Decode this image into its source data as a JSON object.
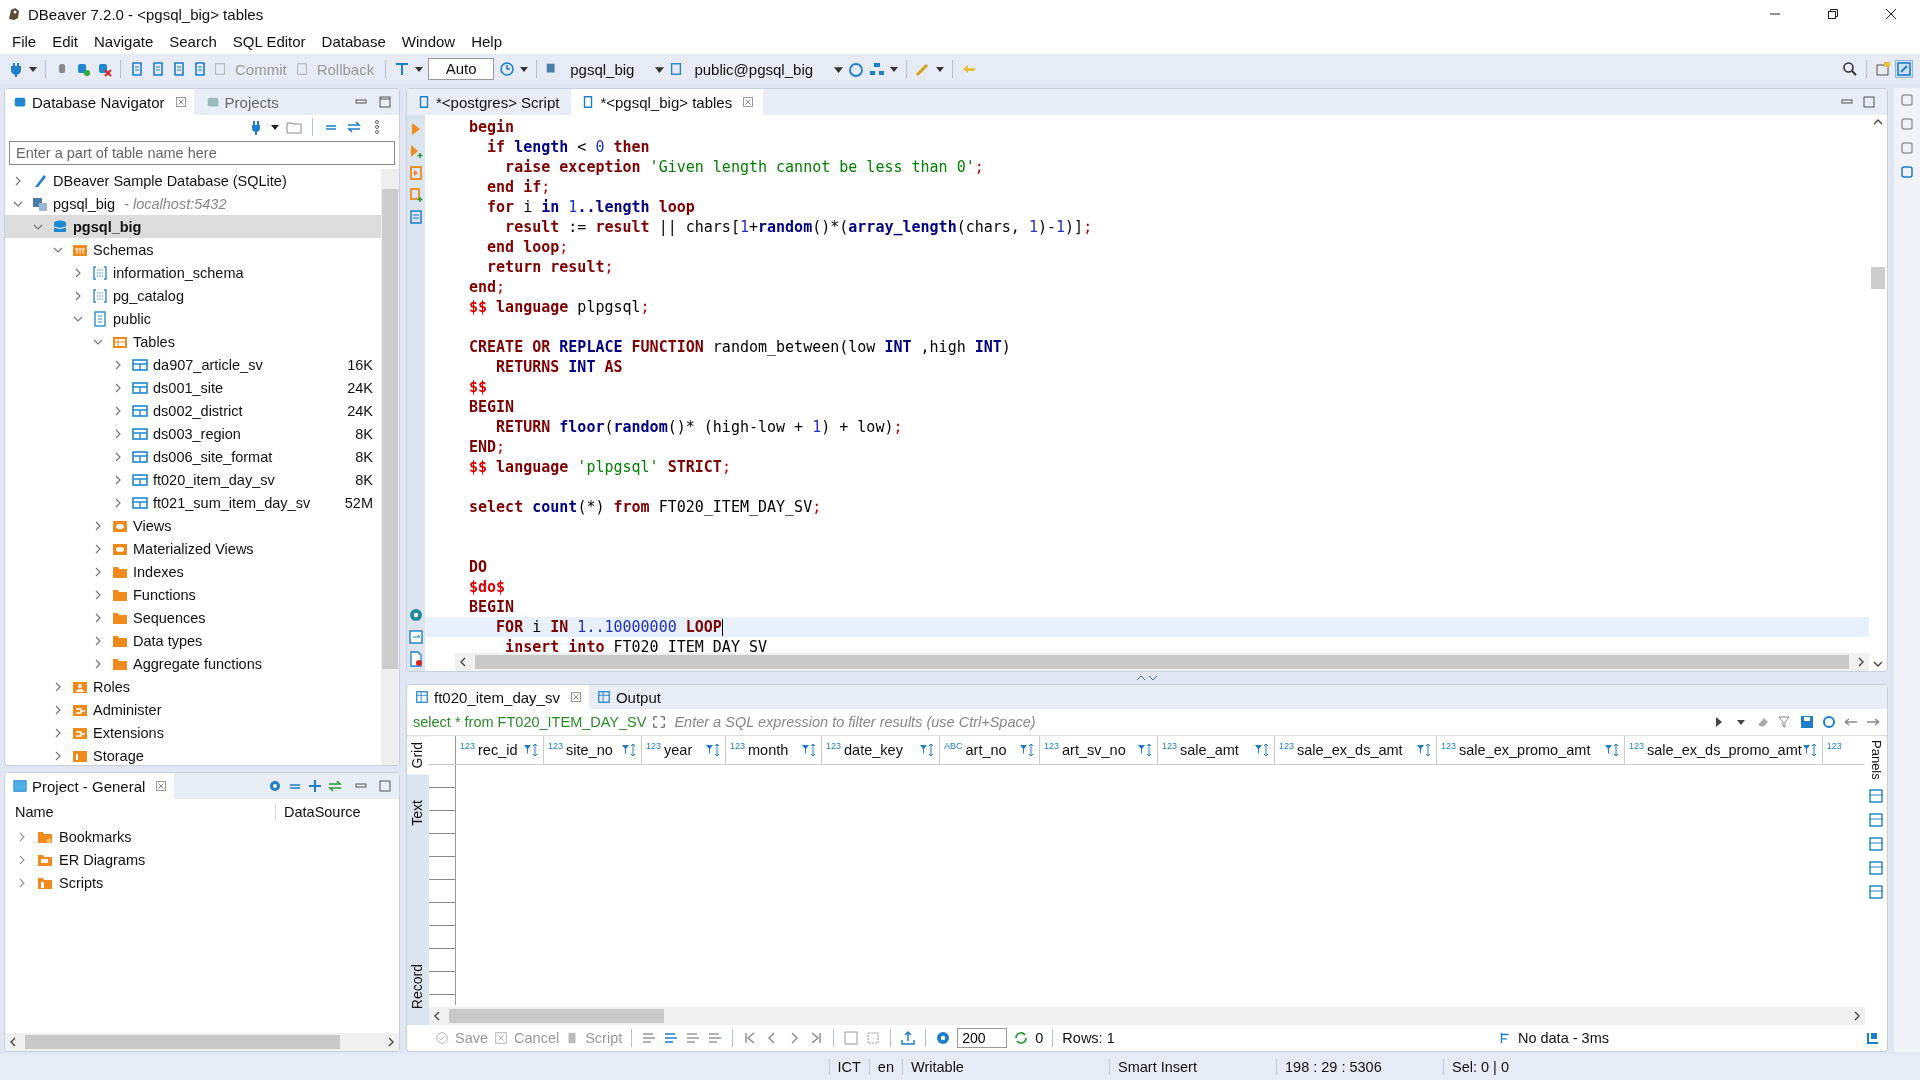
{
  "window": {
    "title": "DBeaver 7.2.0 - <pgsql_big> tables"
  },
  "menu": [
    "File",
    "Edit",
    "Navigate",
    "Search",
    "SQL Editor",
    "Database",
    "Window",
    "Help"
  ],
  "toolbar": {
    "commit": "Commit",
    "rollback": "Rollback",
    "mode": "Auto",
    "datasource": "pgsql_big",
    "schema": "public@pgsql_big"
  },
  "navigator": {
    "tabs": [
      {
        "label": "Database Navigator",
        "selected": true
      },
      {
        "label": "Projects",
        "selected": false
      }
    ],
    "filter_placeholder": "Enter a part of table name here",
    "tree": [
      {
        "label": "DBeaver Sample Database (SQLite)",
        "kind": "sqlite",
        "expanded": false,
        "selected": false
      },
      {
        "label": "pgsql_big",
        "detail": "- localhost:5432",
        "kind": "connection",
        "expanded": true,
        "selected": false,
        "children": [
          {
            "label": "pgsql_big",
            "kind": "database",
            "expanded": true,
            "selected": true,
            "children": [
              {
                "label": "Schemas",
                "kind": "schemas",
                "expanded": true,
                "selected": false,
                "children": [
                  {
                    "label": "information_schema",
                    "kind": "schema",
                    "expanded": false,
                    "selected": false
                  },
                  {
                    "label": "pg_catalog",
                    "kind": "schema",
                    "expanded": false,
                    "selected": false
                  },
                  {
                    "label": "public",
                    "kind": "public",
                    "expanded": true,
                    "selected": false,
                    "children": [
                      {
                        "label": "Tables",
                        "kind": "tables",
                        "expanded": true,
                        "selected": false,
                        "children": [
                          {
                            "label": "da907_article_sv",
                            "size": "16K",
                            "kind": "table",
                            "expanded": false,
                            "selected": false
                          },
                          {
                            "label": "ds001_site",
                            "size": "24K",
                            "kind": "table",
                            "expanded": false,
                            "selected": false
                          },
                          {
                            "label": "ds002_district",
                            "size": "24K",
                            "kind": "table",
                            "expanded": false,
                            "selected": false
                          },
                          {
                            "label": "ds003_region",
                            "size": "8K",
                            "kind": "table",
                            "expanded": false,
                            "selected": false
                          },
                          {
                            "label": "ds006_site_format",
                            "size": "8K",
                            "kind": "table",
                            "expanded": false,
                            "selected": false
                          },
                          {
                            "label": "ft020_item_day_sv",
                            "size": "8K",
                            "kind": "table",
                            "expanded": false,
                            "selected": false
                          },
                          {
                            "label": "ft021_sum_item_day_sv",
                            "size": "52M",
                            "kind": "table",
                            "expanded": false,
                            "selected": false
                          }
                        ]
                      },
                      {
                        "label": "Views",
                        "kind": "view",
                        "expanded": false,
                        "selected": false
                      },
                      {
                        "label": "Materialized Views",
                        "kind": "view",
                        "expanded": false,
                        "selected": false
                      },
                      {
                        "label": "Indexes",
                        "kind": "folder",
                        "expanded": false,
                        "selected": false
                      },
                      {
                        "label": "Functions",
                        "kind": "folder",
                        "expanded": false,
                        "selected": false
                      },
                      {
                        "label": "Sequences",
                        "kind": "folder",
                        "expanded": false,
                        "selected": false
                      },
                      {
                        "label": "Data types",
                        "kind": "folder",
                        "expanded": false,
                        "selected": false
                      },
                      {
                        "label": "Aggregate functions",
                        "kind": "folder",
                        "expanded": false,
                        "selected": false
                      }
                    ]
                  }
                ]
              },
              {
                "label": "Roles",
                "kind": "roles",
                "expanded": false,
                "selected": false
              },
              {
                "label": "Administer",
                "kind": "admin",
                "expanded": false,
                "selected": false
              },
              {
                "label": "Extensions",
                "kind": "admin",
                "expanded": false,
                "selected": false
              },
              {
                "label": "Storage",
                "kind": "storage",
                "expanded": false,
                "selected": false
              }
            ]
          }
        ]
      }
    ]
  },
  "project": {
    "title": "Project - General",
    "columns": [
      "Name",
      "DataSource"
    ],
    "items": [
      {
        "label": "Bookmarks",
        "kind": "bookmarks"
      },
      {
        "label": "ER Diagrams",
        "kind": "diagrams"
      },
      {
        "label": "Scripts",
        "kind": "scripts"
      }
    ]
  },
  "editor": {
    "tabs": [
      {
        "label": "*<postgres> Script",
        "selected": false
      },
      {
        "label": "*<pgsql_big> tables",
        "selected": true
      }
    ],
    "lines": [
      {
        "current": false,
        "tokens": [
          {
            "kind": "kw",
            "text": "begin"
          }
        ]
      },
      {
        "current": false,
        "tokens": [
          {
            "kind": "kw",
            "text": "  if"
          },
          {
            "kind": "name",
            "text": " length"
          },
          {
            "kind": "plain",
            "text": " < "
          },
          {
            "kind": "num",
            "text": "0"
          },
          {
            "kind": "kw",
            "text": " then"
          }
        ]
      },
      {
        "current": false,
        "tokens": [
          {
            "kind": "kw",
            "text": "    raise exception"
          },
          {
            "kind": "str",
            "text": " 'Given length cannot be less than 0'"
          },
          {
            "kind": "punct",
            "text": ";"
          }
        ]
      },
      {
        "current": false,
        "tokens": [
          {
            "kind": "kw",
            "text": "  end if"
          },
          {
            "kind": "punct",
            "text": ";"
          }
        ]
      },
      {
        "current": false,
        "tokens": [
          {
            "kind": "kw",
            "text": "  for"
          },
          {
            "kind": "plain",
            "text": " i "
          },
          {
            "kind": "name",
            "text": "in"
          },
          {
            "kind": "num",
            "text": " 1"
          },
          {
            "kind": "name",
            "text": "..length"
          },
          {
            "kind": "kw",
            "text": " loop"
          }
        ]
      },
      {
        "current": false,
        "tokens": [
          {
            "kind": "kw",
            "text": "    result"
          },
          {
            "kind": "plain",
            "text": " := "
          },
          {
            "kind": "kw",
            "text": "result"
          },
          {
            "kind": "plain",
            "text": " || chars["
          },
          {
            "kind": "num",
            "text": "1"
          },
          {
            "kind": "plain",
            "text": "+"
          },
          {
            "kind": "name",
            "text": "random"
          },
          {
            "kind": "plain",
            "text": "()*("
          },
          {
            "kind": "name",
            "text": "array_length"
          },
          {
            "kind": "plain",
            "text": "(chars, "
          },
          {
            "kind": "num",
            "text": "1"
          },
          {
            "kind": "plain",
            "text": ")-"
          },
          {
            "kind": "num",
            "text": "1"
          },
          {
            "kind": "plain",
            "text": ")]"
          },
          {
            "kind": "punct",
            "text": ";"
          }
        ]
      },
      {
        "current": false,
        "tokens": [
          {
            "kind": "kw",
            "text": "  end loop"
          },
          {
            "kind": "punct",
            "text": ";"
          }
        ]
      },
      {
        "current": false,
        "tokens": [
          {
            "kind": "kw",
            "text": "  return result"
          },
          {
            "kind": "punct",
            "text": ";"
          }
        ]
      },
      {
        "current": false,
        "tokens": [
          {
            "kind": "kw",
            "text": "end"
          },
          {
            "kind": "punct",
            "text": ";"
          }
        ]
      },
      {
        "current": false,
        "tokens": [
          {
            "kind": "var",
            "text": "$$"
          },
          {
            "kind": "kw",
            "text": " language"
          },
          {
            "kind": "plain",
            "text": " plpgsql"
          },
          {
            "kind": "punct",
            "text": ";"
          }
        ]
      },
      {
        "current": false
      },
      {
        "current": false,
        "tokens": [
          {
            "kind": "kw",
            "text": "CREATE OR"
          },
          {
            "kind": "name",
            "text": " REPLACE"
          },
          {
            "kind": "kw",
            "text": " FUNCTION"
          },
          {
            "kind": "plain",
            "text": " random_between(low "
          },
          {
            "kind": "name",
            "text": "INT"
          },
          {
            "kind": "plain",
            "text": " ,high "
          },
          {
            "kind": "name",
            "text": "INT"
          },
          {
            "kind": "plain",
            "text": ")"
          }
        ]
      },
      {
        "current": false,
        "tokens": [
          {
            "kind": "kw",
            "text": "   RETURNS"
          },
          {
            "kind": "name",
            "text": " INT"
          },
          {
            "kind": "kw",
            "text": " AS"
          }
        ]
      },
      {
        "current": false,
        "tokens": [
          {
            "kind": "var",
            "text": "$$"
          }
        ]
      },
      {
        "current": false,
        "tokens": [
          {
            "kind": "kw",
            "text": "BEGIN"
          }
        ]
      },
      {
        "current": false,
        "tokens": [
          {
            "kind": "kw",
            "text": "   RETURN"
          },
          {
            "kind": "name",
            "text": " floor"
          },
          {
            "kind": "plain",
            "text": "("
          },
          {
            "kind": "name",
            "text": "random"
          },
          {
            "kind": "plain",
            "text": "()* (high-low + "
          },
          {
            "kind": "num",
            "text": "1"
          },
          {
            "kind": "plain",
            "text": ") + low)"
          },
          {
            "kind": "punct",
            "text": ";"
          }
        ]
      },
      {
        "current": false,
        "tokens": [
          {
            "kind": "kw",
            "text": "END"
          },
          {
            "kind": "punct",
            "text": ";"
          }
        ]
      },
      {
        "current": false,
        "tokens": [
          {
            "kind": "var",
            "text": "$$"
          },
          {
            "kind": "kw",
            "text": " language"
          },
          {
            "kind": "str",
            "text": " 'plpgsql'"
          },
          {
            "kind": "kw",
            "text": " STRICT"
          },
          {
            "kind": "punct",
            "text": ";"
          }
        ]
      },
      {
        "current": false
      },
      {
        "current": false,
        "tokens": [
          {
            "kind": "kw",
            "text": "select"
          },
          {
            "kind": "name",
            "text": " count"
          },
          {
            "kind": "plain",
            "text": "(*) "
          },
          {
            "kind": "kw",
            "text": "from"
          },
          {
            "kind": "plain",
            "text": " FT020_ITEM_DAY_SV"
          },
          {
            "kind": "punct",
            "text": ";"
          }
        ]
      },
      {
        "current": false
      },
      {
        "current": false
      },
      {
        "current": false,
        "tokens": [
          {
            "kind": "kw",
            "text": "DO"
          }
        ]
      },
      {
        "current": false,
        "tokens": [
          {
            "kind": "var",
            "text": "$do$"
          }
        ]
      },
      {
        "current": false,
        "tokens": [
          {
            "kind": "kw",
            "text": "BEGIN"
          }
        ]
      },
      {
        "current": true,
        "tokens": [
          {
            "kind": "kw",
            "text": "   FOR"
          },
          {
            "kind": "plain",
            "text": " i "
          },
          {
            "kind": "kw",
            "text": "IN"
          },
          {
            "kind": "num",
            "text": " 1..10000000"
          },
          {
            "kind": "kw",
            "text": " LOOP"
          }
        ]
      },
      {
        "current": false,
        "tokens": [
          {
            "kind": "kw",
            "text": "    insert into"
          },
          {
            "kind": "plain",
            "text": " FT020 ITEM DAY SV"
          }
        ]
      }
    ]
  },
  "results": {
    "tabs": [
      {
        "label": "ft020_item_day_sv",
        "selected": true
      },
      {
        "label": "Output",
        "selected": false
      }
    ],
    "query": "select * from FT020_ITEM_DAY_SV",
    "filter_placeholder": "Enter a SQL expression to filter results (use Ctrl+Space)",
    "side_tabs": [
      {
        "label": "Grid",
        "selected": true
      },
      {
        "label": "Text",
        "selected": false
      },
      {
        "label": "Record",
        "selected": false
      }
    ],
    "columns": [
      {
        "type": "123",
        "name": "rec_id"
      },
      {
        "type": "123",
        "name": "site_no"
      },
      {
        "type": "123",
        "name": "year"
      },
      {
        "type": "123",
        "name": "month"
      },
      {
        "type": "123",
        "name": "date_key"
      },
      {
        "type": "ABC",
        "name": "art_no"
      },
      {
        "type": "123",
        "name": "art_sv_no"
      },
      {
        "type": "123",
        "name": "sale_amt"
      },
      {
        "type": "123",
        "name": "sale_ex_ds_amt"
      },
      {
        "type": "123",
        "name": "sale_ex_promo_amt"
      },
      {
        "type": "123",
        "name": "sale_ex_ds_promo_amt"
      }
    ],
    "partial_column_type": "123",
    "panels_label": "Panels",
    "bottom": {
      "save": "Save",
      "cancel": "Cancel",
      "script": "Script",
      "fetch_size": "200",
      "count": "0",
      "rows": "Rows: 1",
      "timing": "No data - 3ms"
    }
  },
  "status_bar": [
    "ICT",
    "en",
    "Writable",
    "Smart Insert",
    "198 : 29 : 5306",
    "Sel: 0 | 0"
  ]
}
